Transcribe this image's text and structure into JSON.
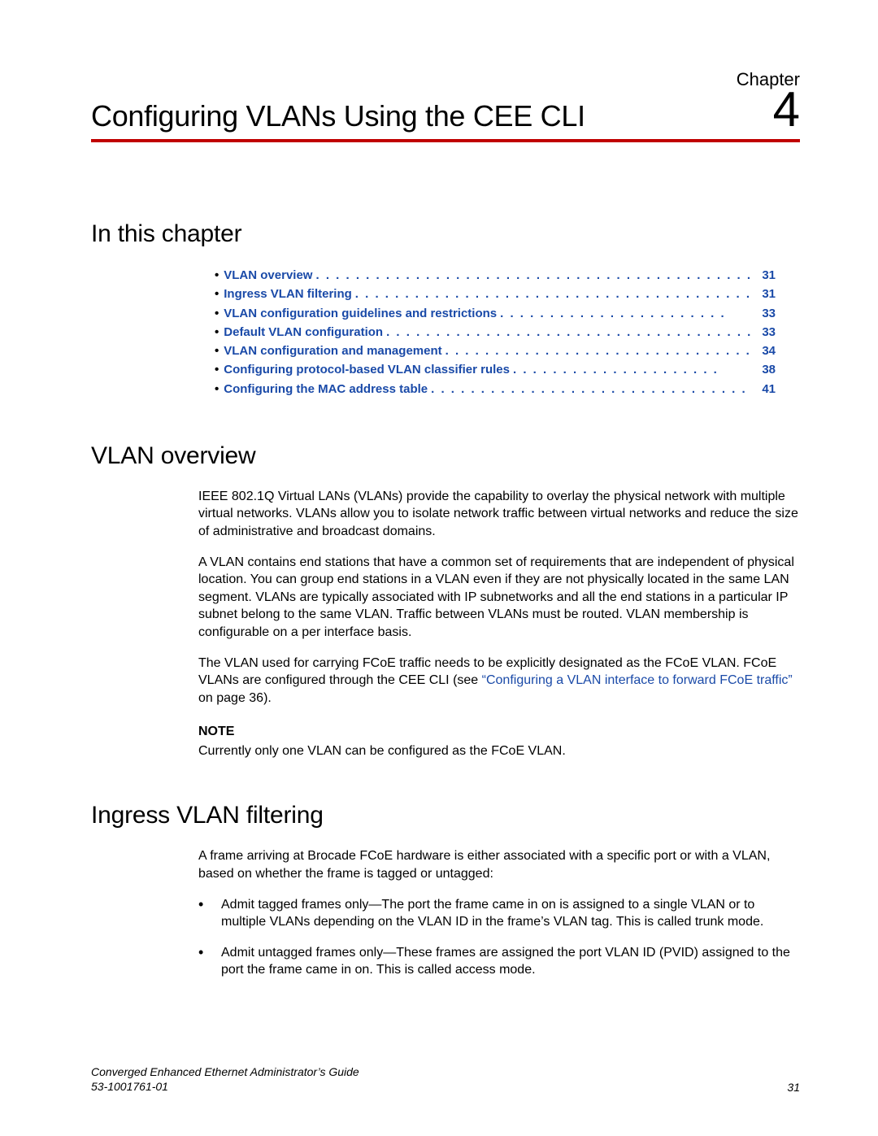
{
  "chapter": {
    "label": "Chapter",
    "number": "4",
    "title": "Configuring VLANs Using the CEE CLI"
  },
  "sections": {
    "in_this_chapter": "In this chapter",
    "vlan_overview": "VLAN overview",
    "ingress_vlan_filtering": "Ingress VLAN filtering"
  },
  "toc": [
    {
      "label": "VLAN overview",
      "page": "31"
    },
    {
      "label": "Ingress VLAN filtering",
      "page": "31"
    },
    {
      "label": "VLAN configuration guidelines and restrictions",
      "page": "33"
    },
    {
      "label": "Default VLAN configuration",
      "page": "33"
    },
    {
      "label": "VLAN configuration and management",
      "page": "34"
    },
    {
      "label": "Configuring protocol-based VLAN classifier rules",
      "page": "38"
    },
    {
      "label": "Configuring the MAC address table",
      "page": "41"
    }
  ],
  "vlan_overview_body": {
    "p1": "IEEE 802.1Q Virtual LANs (VLANs) provide the capability to overlay the physical network with multiple virtual networks. VLANs allow you to isolate network traffic between virtual networks and reduce the size of administrative and broadcast domains.",
    "p2": "A VLAN contains end stations that have a common set of requirements that are independent of physical location. You can group end stations in a VLAN even if they are not physically located in the same LAN segment. VLANs are typically associated with IP subnetworks and all the end stations in a particular IP subnet belong to the same VLAN. Traffic between VLANs must be routed. VLAN membership is configurable on a per interface basis.",
    "p3_pre": "The VLAN used for carrying FCoE traffic needs to be explicitly designated as the FCoE VLAN. FCoE VLANs are configured through the CEE CLI (see ",
    "p3_xref": "“Configuring a VLAN interface to forward FCoE traffic”",
    "p3_post": " on page 36).",
    "note_label": "NOTE",
    "note_text": "Currently only one VLAN can be configured as the FCoE VLAN."
  },
  "ingress_body": {
    "intro": "A frame arriving at Brocade FCoE hardware is either associated with a specific port or with a VLAN, based on whether the frame is tagged or untagged:",
    "bullets": [
      "Admit tagged frames only—The port the frame came in on is assigned to a single VLAN or to multiple VLANs depending on the VLAN ID in the frame’s VLAN tag. This is called trunk mode.",
      "Admit untagged frames only—These frames are assigned the port VLAN ID (PVID) assigned to the port the frame came in on. This is called access mode."
    ]
  },
  "footer": {
    "doc_title": "Converged Enhanced Ethernet Administrator’s Guide",
    "doc_number": "53-1001761-01",
    "page": "31"
  }
}
